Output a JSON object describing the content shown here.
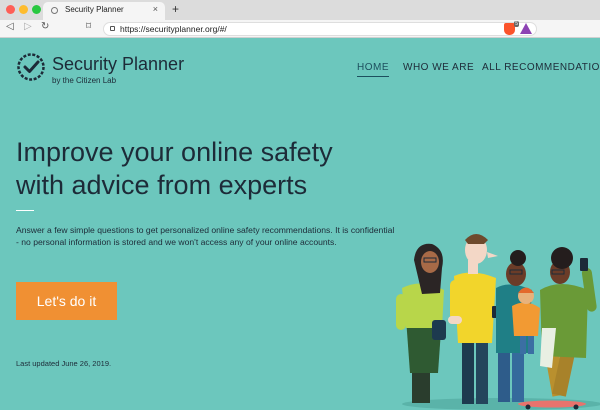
{
  "browser": {
    "tab_title": "Security Planner",
    "tab_close": "×",
    "new_tab": "+",
    "url": "https://securityplanner.org/#/",
    "back": "◁",
    "forward": "▷",
    "reload": "↻",
    "bookmark": "⌑",
    "extension_badge": "5",
    "icons": [
      "back-icon",
      "forward-icon",
      "reload-icon",
      "bookmark-icon",
      "lock-icon",
      "brave-icon",
      "triangle-icon"
    ]
  },
  "site": {
    "logo_title": "Security Planner",
    "logo_subtitle": "by the Citizen Lab",
    "nav": [
      "HOME",
      "WHO WE ARE",
      "ALL RECOMMENDATIONS"
    ],
    "headline_line1": "Improve your online safety",
    "headline_line2": "with advice from experts",
    "intro": "Answer a few simple questions to get personalized online safety recommendations. It is confidential - no personal information is stored and we won't access any of your online accounts.",
    "cta": "Let's do it",
    "updated": "Last updated June 26, 2019."
  },
  "colors": {
    "background": "#6cc7bd",
    "text": "#1d2b38",
    "cta": "#f09033"
  }
}
